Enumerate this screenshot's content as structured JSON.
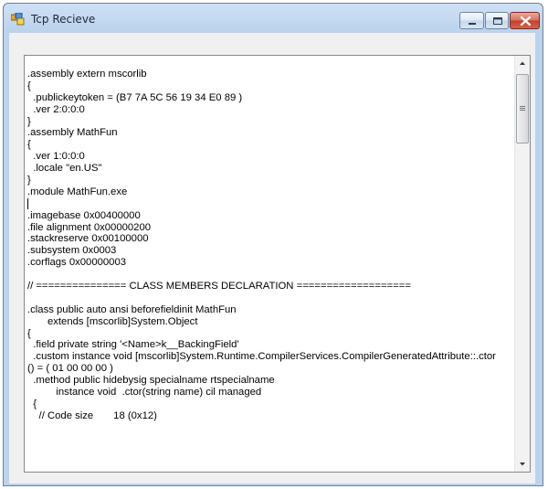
{
  "window": {
    "title": "Tcp Recieve",
    "controls": {
      "minimize_icon": "minimize-icon",
      "maximize_icon": "maximize-icon",
      "close_icon": "close-icon"
    }
  },
  "textbox": {
    "lines": [
      ".assembly extern mscorlib",
      "{",
      "  .publickeytoken = (B7 7A 5C 56 19 34 E0 89 )",
      "  .ver 2:0:0:0",
      "}",
      ".assembly MathFun",
      "{",
      "  .ver 1:0:0:0",
      "  .locale \"en.US\"",
      "}",
      ".module MathFun.exe",
      "",
      ".imagebase 0x00400000",
      ".file alignment 0x00000200",
      ".stackreserve 0x00100000",
      ".subsystem 0x0003",
      ".corflags 0x00000003",
      "",
      "// =============== CLASS MEMBERS DECLARATION ===================",
      "",
      ".class public auto ansi beforefieldinit MathFun",
      "       extends [mscorlib]System.Object",
      "{",
      "  .field private string '<Name>k__BackingField'",
      "  .custom instance void [mscorlib]System.Runtime.CompilerServices.CompilerGeneratedAttribute::.ctor",
      "() = ( 01 00 00 00 )",
      "  .method public hidebysig specialname rtspecialname",
      "          instance void  .ctor(string name) cil managed",
      "  {",
      "    // Code size       18 (0x12)"
    ]
  },
  "colors": {
    "titlebar": "#bcd3ec",
    "close_button": "#c0402c"
  }
}
